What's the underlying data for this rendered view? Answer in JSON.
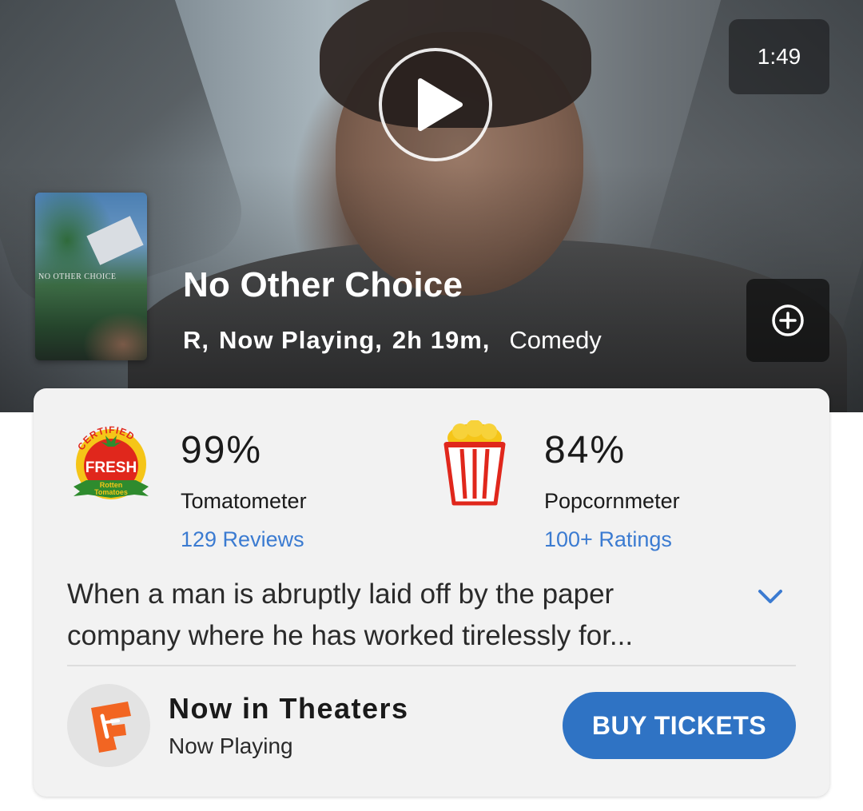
{
  "video": {
    "duration": "1:49"
  },
  "movie": {
    "poster_text": "NO OTHER CHOICE",
    "title": "No Other Choice",
    "rating": "R,",
    "status": "Now Playing,",
    "runtime": "2h 19m,",
    "genre": "Comedy"
  },
  "scores": {
    "tomatometer": {
      "badge_top": "CERTIFIED",
      "badge_main": "FRESH",
      "badge_brand_line1": "Rotten",
      "badge_brand_line2": "Tomatoes",
      "value": "99%",
      "label": "Tomatometer",
      "link": "129 Reviews"
    },
    "popcornmeter": {
      "value": "84%",
      "label": "Popcornmeter",
      "link": "100+ Ratings"
    }
  },
  "synopsis": {
    "line1": "When a man is abruptly laid off by the paper",
    "line2": "company where he has worked tirelessly for..."
  },
  "theaters": {
    "title": "Now in Theaters",
    "subtitle": "Now Playing",
    "button": "BUY TICKETS"
  },
  "icons": {
    "play": "play-icon",
    "add": "plus-circle-icon",
    "chevron": "chevron-down-icon",
    "fandango": "fandango-logo-icon"
  },
  "colors": {
    "link": "#3b7bd1",
    "button": "#2f73c4",
    "fresh_red": "#e0271c",
    "fandango_orange": "#f26522"
  }
}
